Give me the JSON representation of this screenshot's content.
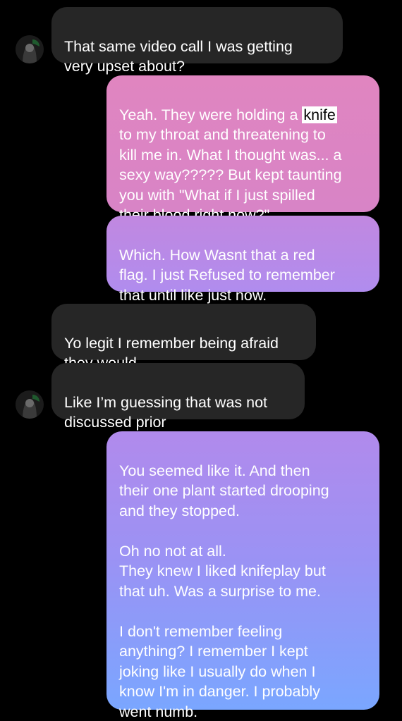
{
  "messages": [
    {
      "id": "m1",
      "sender": "other",
      "text": "That same video call I was getting\nvery upset about?"
    },
    {
      "id": "m2",
      "sender": "me",
      "text_before": "Yeah. They were holding a ",
      "highlight": "knife",
      "text_after": "\nto my throat and threatening to\nkill me in. What I thought was... a\nsexy way????? But kept taunting\nyou with \"What if I just spilled\ntheir blood right now?\""
    },
    {
      "id": "m3",
      "sender": "me",
      "text": "Which. How Wasnt that a red\nflag. I just Refused to remember\nthat until like just now."
    },
    {
      "id": "m4",
      "sender": "other",
      "text": "Yo legit I remember being afraid\nthey would"
    },
    {
      "id": "m5",
      "sender": "other",
      "text": "Like I’m guessing that was not\ndiscussed prior"
    },
    {
      "id": "m6",
      "sender": "me",
      "text": "You seemed like it. And then\ntheir one plant started drooping\nand they stopped.\n\nOh no not at all.\nThey knew I liked knifeplay but\nthat uh. Was a surprise to me.\n\nI don't remember feeling\nanything? I remember I kept\njoking like I usually do when I\nknow I'm in danger. I probably\nwent numb."
    }
  ],
  "colors": {
    "background": "#000000",
    "incoming_bubble": "#262626",
    "outgoing_top": "#e07fc0",
    "outgoing_mid": "#a98cf0",
    "outgoing_bottom": "#6fa8ff"
  },
  "avatar_icon": "user-avatar-icon"
}
